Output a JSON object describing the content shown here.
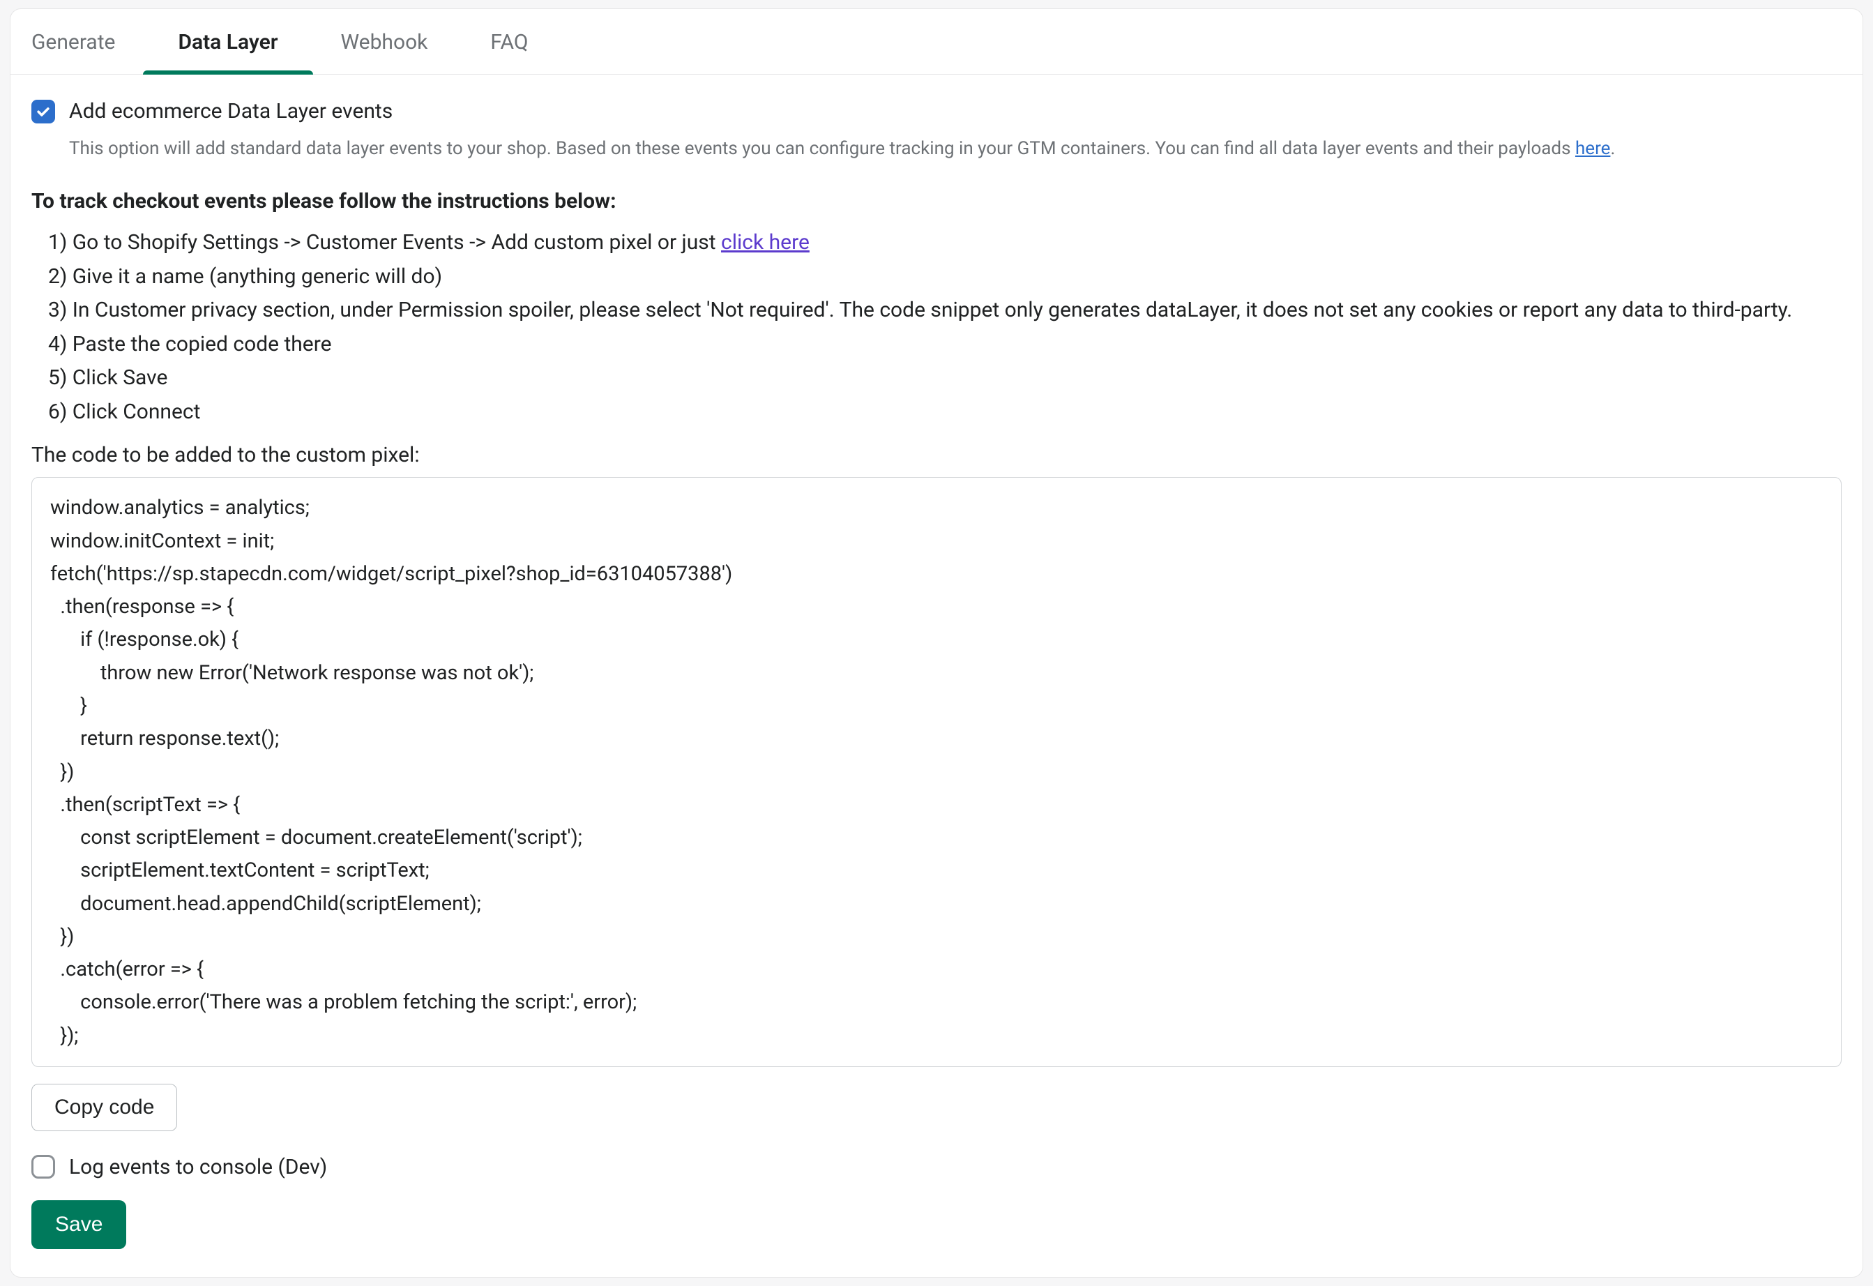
{
  "tabs": {
    "generate": "Generate",
    "data_layer": "Data Layer",
    "webhook": "Webhook",
    "faq": "FAQ"
  },
  "checkbox1": {
    "label": "Add ecommerce Data Layer events",
    "helper_pre": "This option will add standard data layer events to your shop. Based on these events you can configure tracking in your GTM containers. You can find all data layer events and their payloads ",
    "helper_link": "here",
    "helper_post": "."
  },
  "instructions_title": "To track checkout events please follow the instructions below:",
  "instructions": [
    {
      "prefix": "1) Go to Shopify Settings -> Customer Events -> Add custom pixel or just ",
      "link": "click here",
      "suffix": ""
    },
    {
      "prefix": "2) Give it a name (anything generic will do)",
      "link": "",
      "suffix": ""
    },
    {
      "prefix": "3) In Customer privacy section, under Permission spoiler, please select 'Not required'. The code snippet only generates dataLayer, it does not set any cookies or report any data to third-party.",
      "link": "",
      "suffix": ""
    },
    {
      "prefix": "4) Paste the copied code there",
      "link": "",
      "suffix": ""
    },
    {
      "prefix": "5) Click Save",
      "link": "",
      "suffix": ""
    },
    {
      "prefix": "6) Click Connect",
      "link": "",
      "suffix": ""
    }
  ],
  "code_label": "The code to be added to the custom pixel:",
  "code": "window.analytics = analytics;\nwindow.initContext = init;\nfetch('https://sp.stapecdn.com/widget/script_pixel?shop_id=63104057388')\n  .then(response => {\n      if (!response.ok) {\n          throw new Error('Network response was not ok');\n      }\n      return response.text();\n  })\n  .then(scriptText => {\n      const scriptElement = document.createElement('script');\n      scriptElement.textContent = scriptText;\n      document.head.appendChild(scriptElement);\n  })\n  .catch(error => {\n      console.error('There was a problem fetching the script:', error);\n  });",
  "copy_label": "Copy code",
  "log_label": "Log events to console (Dev)",
  "save_label": "Save"
}
